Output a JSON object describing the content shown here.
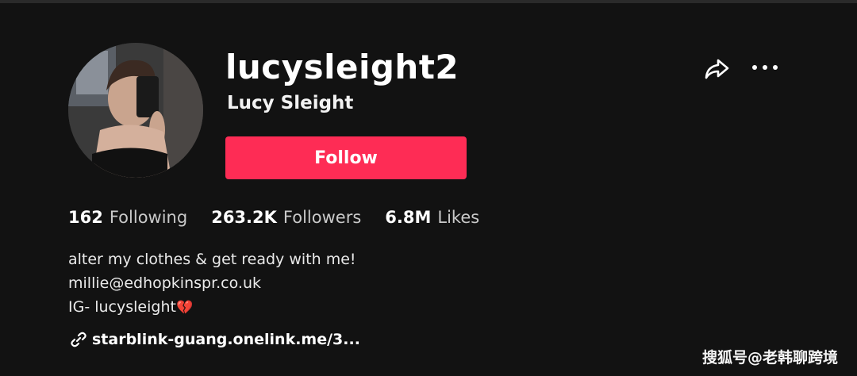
{
  "profile": {
    "username": "lucysleight2",
    "display_name": "Lucy Sleight",
    "follow_label": "Follow"
  },
  "stats": [
    {
      "value": "162",
      "label": "Following"
    },
    {
      "value": "263.2K",
      "label": "Followers"
    },
    {
      "value": "6.8M",
      "label": "Likes"
    }
  ],
  "bio": {
    "line1": "alter my clothes & get ready with me!",
    "line2": "millie@edhopkinspr.co.uk",
    "line3": "IG- lucysleight",
    "line3_emoji": "💔"
  },
  "link": {
    "text": "starblink-guang.onelink.me/3...",
    "icon": "link-icon"
  },
  "icons": {
    "share": "share-icon",
    "more": "more-icon"
  },
  "watermark": {
    "text": "搜狐号@老韩聊跨境"
  },
  "colors": {
    "background": "#121212",
    "follow_button": "#fe2c55",
    "text_primary": "#ffffff",
    "text_secondary": "#c9c9c9"
  }
}
